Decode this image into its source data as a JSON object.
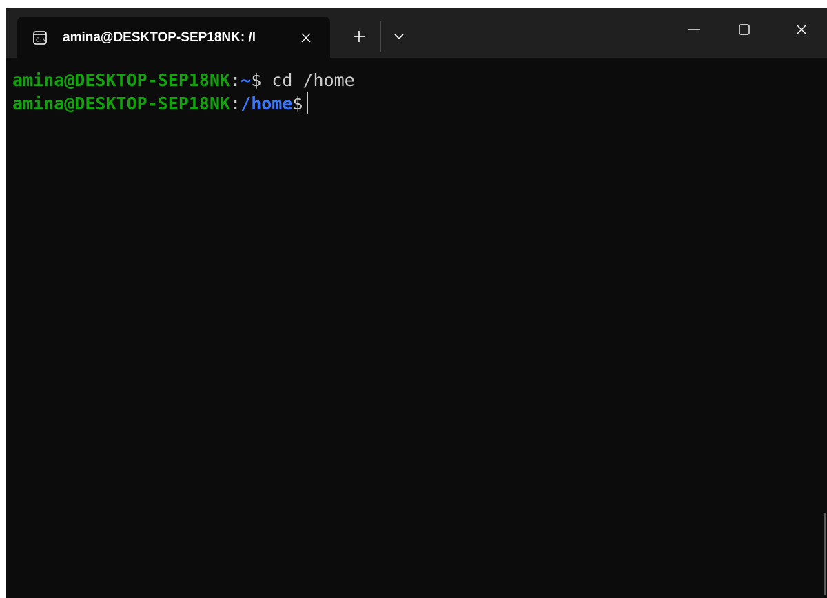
{
  "window": {
    "tab_title": "amina@DESKTOP-SEP18NK: /l",
    "tab_icon": "terminal-icon",
    "new_tab_icon": "plus-icon",
    "dropdown_icon": "chevron-down-icon",
    "controls": [
      "minimize-icon",
      "maximize-icon",
      "close-icon"
    ]
  },
  "terminal": {
    "lines": [
      {
        "user_host": "amina@DESKTOP-SEP18NK",
        "separator": ":",
        "path": "~",
        "prompt": "$",
        "command": " cd /home"
      },
      {
        "user_host": "amina@DESKTOP-SEP18NK",
        "separator": ":",
        "path": "/home",
        "prompt": "$",
        "command": ""
      }
    ]
  },
  "colors": {
    "background": "#0c0c0c",
    "titlebar": "#202020",
    "user_host": "#13a10e",
    "path": "#3b78ff",
    "text": "#cccccc"
  }
}
